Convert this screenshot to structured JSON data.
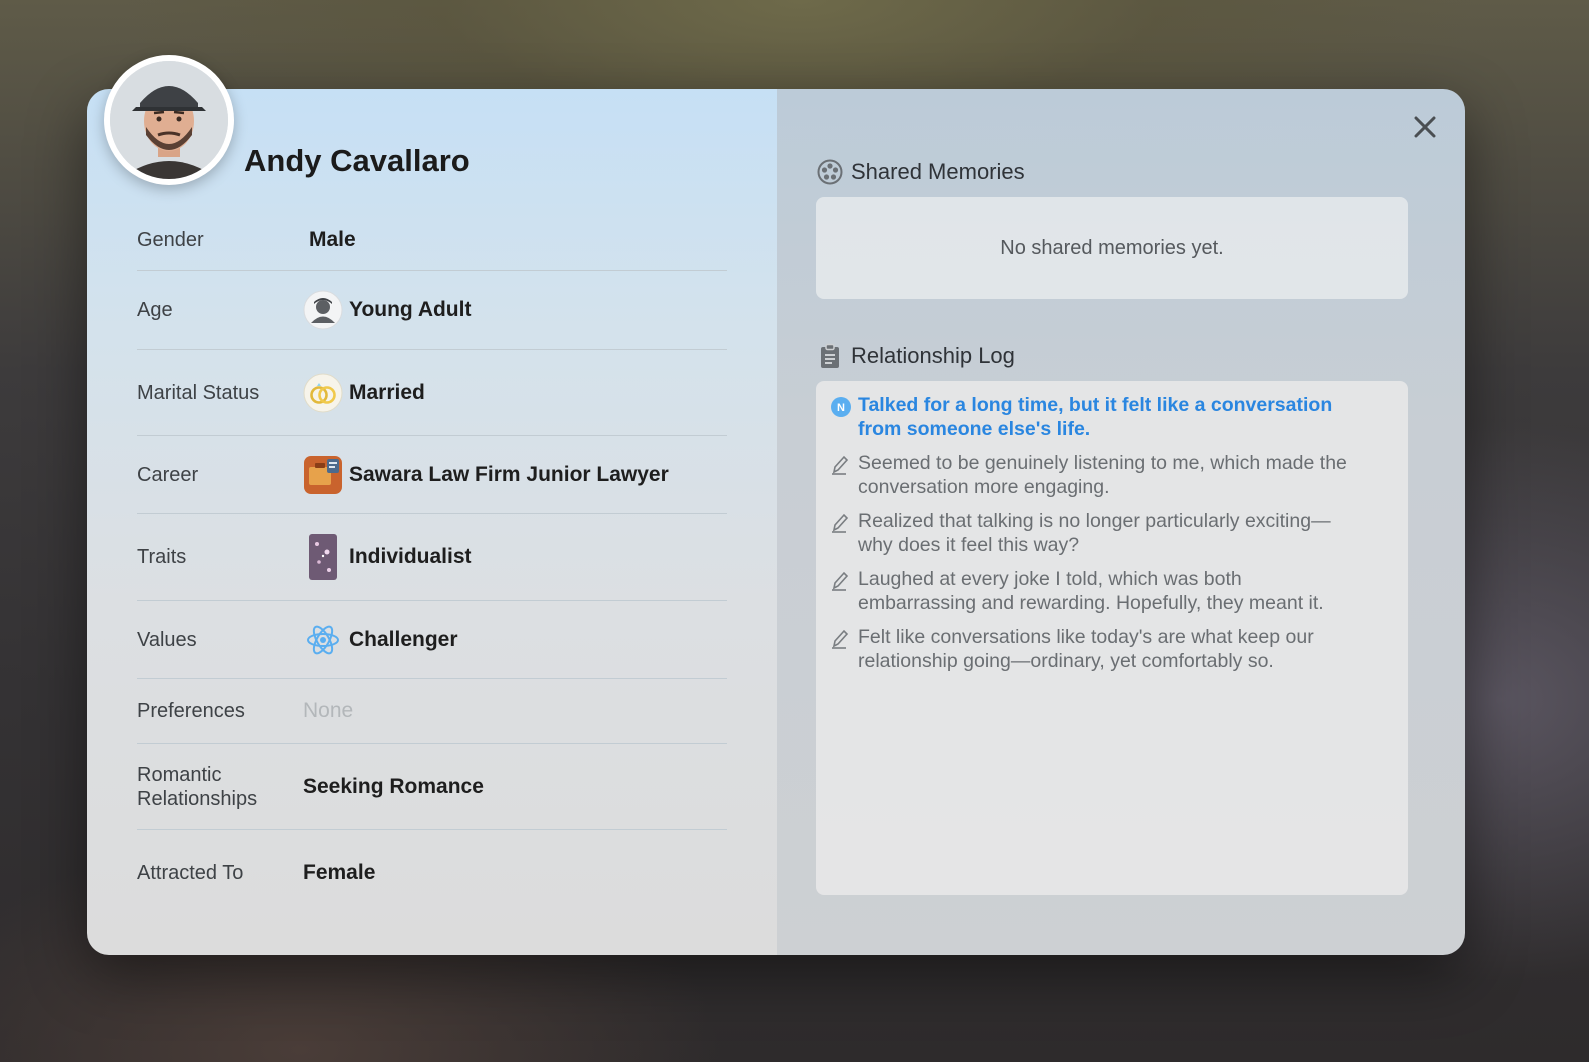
{
  "profile": {
    "name": "Andy Cavallaro"
  },
  "details": [
    {
      "label": "Gender",
      "value": "Male",
      "icon": "none"
    },
    {
      "label": "Age",
      "value": "Young Adult",
      "icon": "young-adult-icon"
    },
    {
      "label": "Marital Status",
      "value": "Married",
      "icon": "rings-icon"
    },
    {
      "label": "Career",
      "value": "Sawara Law Firm Junior Lawyer",
      "icon": "briefcase-icon"
    },
    {
      "label": "Traits",
      "value": "Individualist",
      "icon": "trait-card-icon"
    },
    {
      "label": "Values",
      "value": "Challenger",
      "icon": "atom-icon"
    },
    {
      "label": "Preferences",
      "value": "None",
      "icon": "none"
    },
    {
      "label": "Romantic Relationships",
      "value": "Seeking Romance",
      "icon": "none"
    },
    {
      "label": "Attracted To",
      "value": "Female",
      "icon": "none"
    }
  ],
  "shared_memories": {
    "title": "Shared Memories",
    "empty_text": "No shared memories yet."
  },
  "relationship_log": {
    "title": "Relationship Log",
    "entries": [
      {
        "text": "Talked for a long time, but it felt like a conversation from someone else's life.",
        "is_new": true,
        "badge": "N"
      },
      {
        "text": "Seemed to be genuinely listening to me, which made the conversation more engaging.",
        "is_new": false
      },
      {
        "text": "Realized that talking is no longer particularly exciting—why does it feel this way?",
        "is_new": false
      },
      {
        "text": "Laughed at every joke I told, which was both embarrassing and rewarding. Hopefully, they meant it.",
        "is_new": false
      },
      {
        "text": "Felt like conversations like today's are what keep our relationship going—ordinary, yet comfortably so.",
        "is_new": false
      }
    ]
  },
  "colors": {
    "accent_blue": "#2a86e0",
    "muted_text": "#b3b7ba"
  }
}
